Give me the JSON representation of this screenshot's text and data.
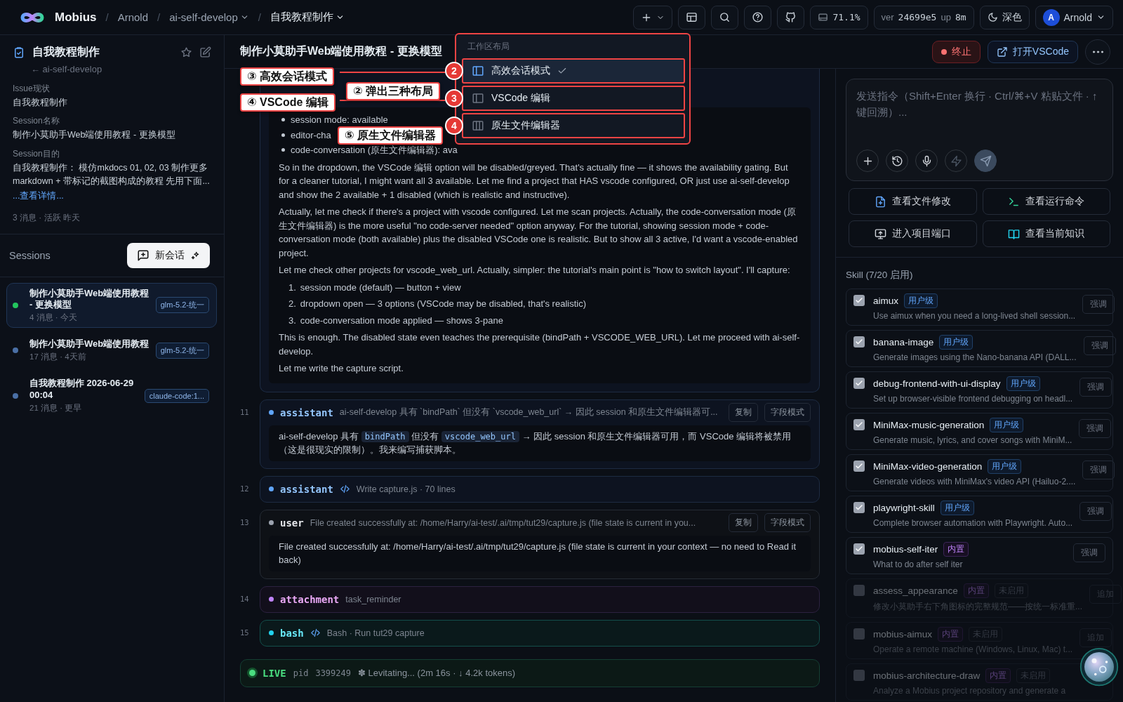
{
  "topbar": {
    "brand": "Mobius",
    "separator": "/",
    "breadcrumbs": [
      {
        "label": "Arnold",
        "dropdown": false
      },
      {
        "label": "ai-self-develop",
        "dropdown": true
      },
      {
        "label": "自我教程制作",
        "dropdown": true
      }
    ],
    "disk": "71.1%",
    "version_label": "ver",
    "version": "24699e5",
    "uptime_label": "up",
    "uptime": "8m",
    "theme": "深色",
    "user": {
      "initial": "A",
      "name": "Arnold"
    }
  },
  "issue": {
    "title": "自我教程制作",
    "parent": "← ai-self-develop",
    "fields": [
      {
        "label": "Issue现状",
        "value": "自我教程制作"
      },
      {
        "label": "Session名称",
        "value": "制作小莫助手Web端使用教程 - 更换模型"
      },
      {
        "label": "Session目的",
        "value": "自我教程制作： 模仿mkdocs 01, 02, 03 制作更多 markdown + 带标记的截图构成的教程 先用下面..."
      }
    ],
    "more_link": "...查看详情...",
    "meta": "3 消息 · 活跃 昨天"
  },
  "sessions": {
    "title": "Sessions",
    "new_button": "新会话",
    "items": [
      {
        "title": "制作小莫助手Web端使用教程 - 更换模型",
        "meta": "4 消息 · 今天",
        "model": "glm-5.2-统一",
        "selected": true,
        "color": "#22c55e"
      },
      {
        "title": "制作小莫助手Web端使用教程",
        "meta": "17 消息 · 4天前",
        "model": "glm-5.2-统一",
        "selected": false,
        "color": "#4a6fa5"
      },
      {
        "title": "自我教程制作 2026-06-29 00:04",
        "meta": "21 消息 · 更早",
        "model": "claude-code:1...",
        "selected": false,
        "color": "#4a6fa5"
      }
    ]
  },
  "chat": {
    "title": "制作小莫助手Web端使用教程 - 更换模型",
    "stop_button": "终止",
    "vscode_button": "打开VSCode"
  },
  "message_tail": {
    "kind": "assistant",
    "blocks": [
      {
        "kind": "bullets",
        "items": [
          "session mode: available",
          "editor-cha",
          "code-conversation (原生文件编辑器): ava"
        ]
      },
      {
        "kind": "paragraph",
        "text": "So in the dropdown, the VSCode 编辑 option will be disabled/greyed. That's actually fine — it shows the availability gating. But for a cleaner tutorial, I might want all 3 available. Let me find a project that HAS vscode configured, OR just use ai-self-develop and show the 2 available + 1 disabled (which is realistic and instructive)."
      },
      {
        "kind": "paragraph",
        "text": "Actually, let me check if there's a project with vscode configured. Let me scan projects. Actually, the code-conversation mode (原生文件编辑器) is the more useful \"no code-server needed\" option anyway. For the tutorial, showing session mode + code-conversation mode (both available) plus the disabled VSCode one is realistic. But to show all 3 active, I'd want a vscode-enabled project."
      },
      {
        "kind": "paragraph",
        "text": "Let me check other projects for vscode_web_url. Actually, simpler: the tutorial's main point is \"how to switch layout\". I'll capture:"
      },
      {
        "kind": "numbered",
        "items": [
          {
            "number": "1.",
            "text": "session mode (default) — button + view"
          },
          {
            "number": "2.",
            "text": "dropdown open — 3 options (VSCode may be disabled, that's realistic)"
          },
          {
            "number": "3.",
            "text": "code-conversation mode applied — shows 3-pane"
          }
        ]
      },
      {
        "kind": "paragraph",
        "text": "This is enough. The disabled state even teaches the prerequisite (bindPath + VSCODE_WEB_URL). Let me proceed with ai-self-develop."
      },
      {
        "kind": "paragraph",
        "text": "Let me write the capture script."
      }
    ]
  },
  "messages": [
    {
      "number": "11",
      "kind": "assistant",
      "role": "assistant",
      "color": "#60a5fa",
      "tool_call": false,
      "summary": "ai-self-develop 具有 `bindPath` 但没有 `vscode_web_url` → 因此 session 和原生文件编辑器可...",
      "actions": [
        "复制",
        "字段模式"
      ],
      "body": [
        {
          "text": "ai-self-develop 具有 ",
          "code": false
        },
        {
          "text": "bindPath",
          "code": true
        },
        {
          "text": " 但没有 ",
          "code": false
        },
        {
          "text": "vscode_web_url",
          "code": true
        },
        {
          "text": " → 因此 session 和原生文件编辑器可用，而 VSCode 编辑将被禁用（这是很现实的限制）。我来编写捕获脚本。",
          "code": false
        }
      ]
    },
    {
      "number": "12",
      "kind": "assistant",
      "role": "assistant",
      "color": "#60a5fa",
      "tool_call": true,
      "summary": "Write capture.js · 70 lines"
    },
    {
      "number": "13",
      "kind": "user",
      "role": "user",
      "color": "#9ca3af",
      "tool_call": false,
      "summary": "File created successfully at: /home/Harry/ai-test/.ai/tmp/tut29/capture.js (file state is current in you...",
      "actions": [
        "复制",
        "字段模式"
      ],
      "body": [
        {
          "text": "File created successfully at: /home/Harry/ai-test/.ai/tmp/tut29/capture.js (file state is current in your context — no need to Read it back)",
          "code": false
        }
      ]
    },
    {
      "number": "14",
      "kind": "attachment",
      "role": "attachment",
      "color": "#c084fc",
      "tool_call": false,
      "summary": "task_reminder"
    },
    {
      "number": "15",
      "kind": "bash",
      "role": "bash",
      "color": "#22d3ee",
      "tool_call": true,
      "summary": "Bash · Run tut29 capture"
    }
  ],
  "live": {
    "label": "LIVE",
    "pid_label": "pid",
    "pid": "3399249",
    "status": "✽ Levitating... (2m 16s · ↓ 4.2k tokens)"
  },
  "composer": {
    "placeholder": "发送指令（Shift+Enter 换行 · Ctrl/⌘+V 粘贴文件 · ↑键回溯）..."
  },
  "quick_actions": [
    "查看文件修改",
    "查看运行命令",
    "进入项目端口",
    "查看当前知识"
  ],
  "skills": {
    "title": "Skill (7/20 启用)",
    "items": [
      {
        "name": "aimux",
        "tag": {
          "label": "用户级",
          "kind": "user"
        },
        "checked": true,
        "description": "Use aimux when you need a long-lived shell session...",
        "action": "强调"
      },
      {
        "name": "banana-image",
        "tag": {
          "label": "用户级",
          "kind": "user"
        },
        "checked": true,
        "description": "Generate images using the Nano-banana API (DALL...",
        "action": "强调"
      },
      {
        "name": "debug-frontend-with-ui-display",
        "tag": {
          "label": "用户级",
          "kind": "user"
        },
        "checked": true,
        "description": "Set up browser-visible frontend debugging on headl...",
        "action": "强调"
      },
      {
        "name": "MiniMax-music-generation",
        "tag": {
          "label": "用户级",
          "kind": "user"
        },
        "checked": true,
        "description": "Generate music, lyrics, and cover songs with MiniM...",
        "action": "强调"
      },
      {
        "name": "MiniMax-video-generation",
        "tag": {
          "label": "用户级",
          "kind": "user"
        },
        "checked": true,
        "description": "Generate videos with MiniMax's video API (Hailuo-2....",
        "action": "强调"
      },
      {
        "name": "playwright-skill",
        "tag": {
          "label": "用户级",
          "kind": "user"
        },
        "checked": true,
        "description": "Complete browser automation with Playwright. Auto...",
        "action": "强调"
      },
      {
        "name": "mobius-self-iter",
        "tag": {
          "label": "内置",
          "kind": "builtin"
        },
        "checked": true,
        "description": "What to do after self iter",
        "action": "强调"
      },
      {
        "name": "assess_appearance",
        "tag": {
          "label": "内置",
          "kind": "builtin"
        },
        "status": "未启用",
        "checked": false,
        "description": "修改小莫助手右下角图标的完整规范——按统一标准重...",
        "action": "追加"
      },
      {
        "name": "mobius-aimux",
        "tag": {
          "label": "内置",
          "kind": "builtin"
        },
        "status": "未启用",
        "checked": false,
        "description": "Operate a remote machine (Windows, Linux, Mac) t...",
        "action": "追加"
      },
      {
        "name": "mobius-architecture-draw",
        "tag": {
          "label": "内置",
          "kind": "builtin"
        },
        "status": "未启用",
        "checked": false,
        "description": "Analyze a Mobius project repository and generate a"
      }
    ]
  },
  "layout_menu": {
    "title": "工作区布局",
    "items": [
      {
        "label": "高效会话模式",
        "selected": true
      },
      {
        "label": "VSCode 编辑",
        "selected": false
      },
      {
        "label": "原生文件编辑器",
        "selected": false
      }
    ]
  },
  "annotations": {
    "callouts": [
      "③ 高效会话模式",
      "② 弹出三种布局",
      "④ VSCode 编辑",
      "⑤ 原生文件编辑器"
    ],
    "markers": [
      "2",
      "3",
      "4"
    ]
  }
}
